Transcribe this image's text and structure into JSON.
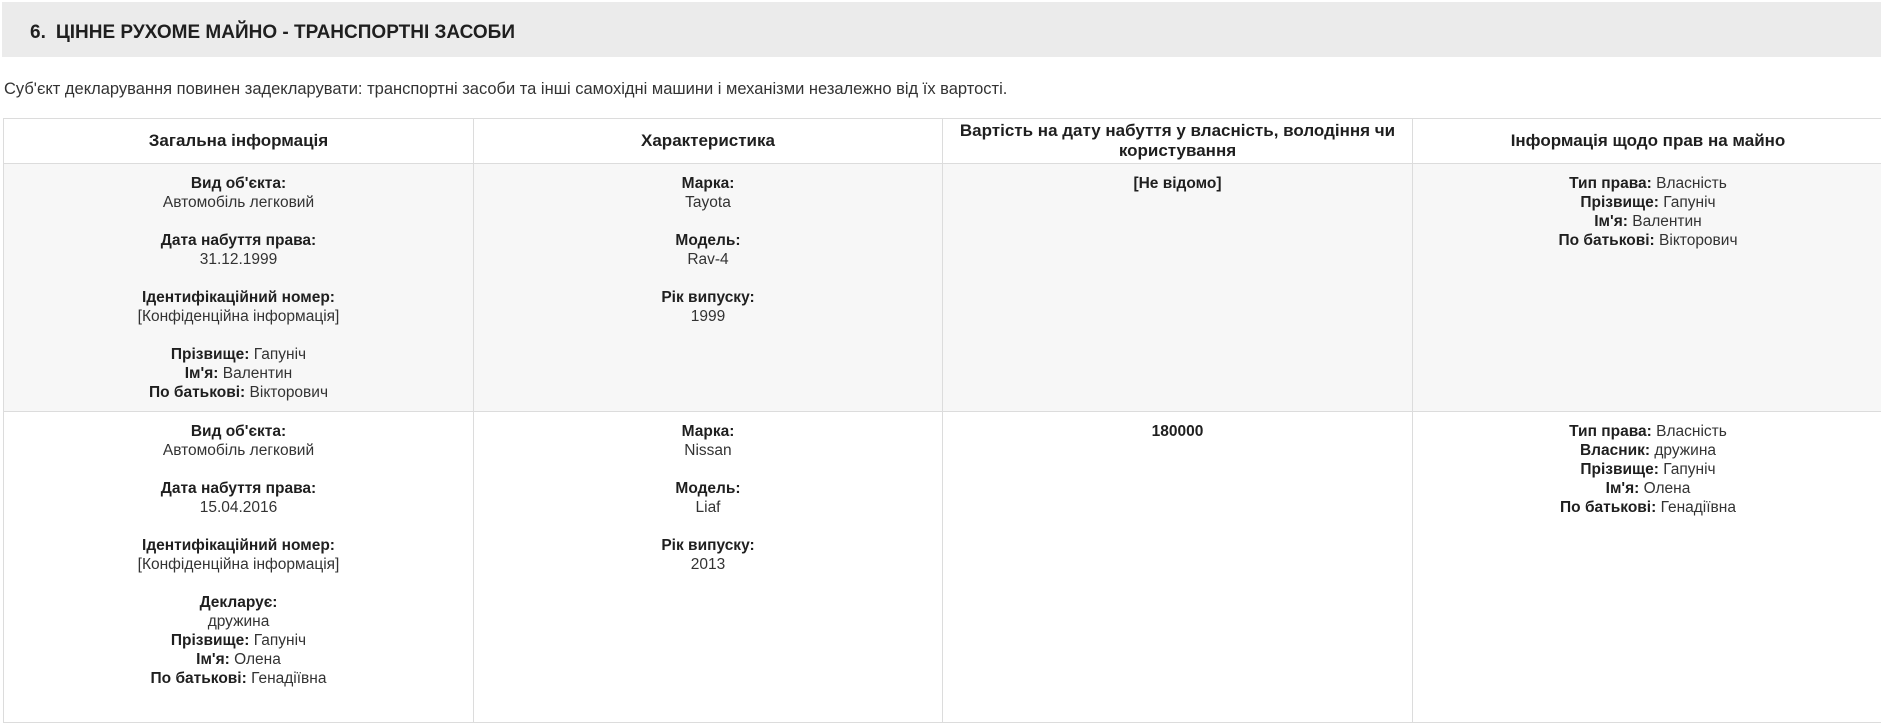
{
  "section": {
    "number": "6.",
    "title": "ЦІННЕ РУХОМЕ МАЙНО - ТРАНСПОРТНІ ЗАСОБИ",
    "intro": "Суб'єкт декларування повинен задекларувати: транспортні засоби та інші самохідні машини і механізми незалежно від їх вартості."
  },
  "table": {
    "headers": [
      "Загальна інформація",
      "Характеристика",
      "Вартість на дату набуття у власність, володіння чи користування",
      "Інформація щодо прав на майно"
    ],
    "rows": [
      {
        "general": {
          "object_type_label": "Вид об'єкта:",
          "object_type": "Автомобіль легковий",
          "acquired_label": "Дата набуття права:",
          "acquired": "31.12.1999",
          "id_label": "Ідентифікаційний номер:",
          "id": "[Конфіденційна інформація]",
          "surname_label": "Прізвище:",
          "surname": "Гапуніч",
          "name_label": "Ім'я:",
          "name": "Валентин",
          "patronymic_label": "По батькові:",
          "patronymic": "Вікторович"
        },
        "specs": {
          "brand_label": "Марка:",
          "brand": "Tayota",
          "model_label": "Модель:",
          "model": "Rav-4",
          "year_label": "Рік випуску:",
          "year": "1999"
        },
        "value": "[Не відомо]",
        "rights": {
          "type_label": "Тип права:",
          "type": "Власність",
          "surname_label": "Прізвище:",
          "surname": "Гапуніч",
          "name_label": "Ім'я:",
          "name": "Валентин",
          "patronymic_label": "По батькові:",
          "patronymic": "Вікторович"
        }
      },
      {
        "general": {
          "object_type_label": "Вид об'єкта:",
          "object_type": "Автомобіль легковий",
          "acquired_label": "Дата набуття права:",
          "acquired": "15.04.2016",
          "id_label": "Ідентифікаційний номер:",
          "id": "[Конфіденційна інформація]",
          "declarant_label": "Декларує:",
          "declarant": "дружина",
          "surname_label": "Прізвище:",
          "surname": "Гапуніч",
          "name_label": "Ім'я:",
          "name": "Олена",
          "patronymic_label": "По батькові:",
          "patronymic": "Генадіївна"
        },
        "specs": {
          "brand_label": "Марка:",
          "brand": "Nissan",
          "model_label": "Модель:",
          "model": "Liaf",
          "year_label": "Рік випуску:",
          "year": "2013"
        },
        "value": "180000",
        "rights": {
          "type_label": "Тип права:",
          "type": "Власність",
          "owner_label": "Власник:",
          "owner": "дружина",
          "surname_label": "Прізвище:",
          "surname": "Гапуніч",
          "name_label": "Ім'я:",
          "name": "Олена",
          "patronymic_label": "По батькові:",
          "patronymic": "Генадіївна"
        }
      }
    ]
  }
}
